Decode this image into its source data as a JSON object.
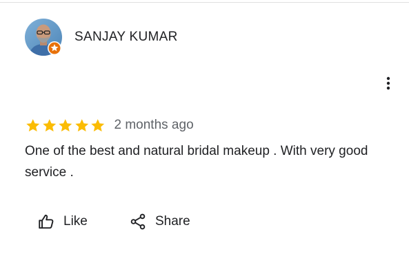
{
  "review": {
    "author": "SANJAY KUMAR",
    "avatar_icon": "user-photo-avatar",
    "badge_icon": "local-guide-star-badge",
    "rating": 5,
    "rating_max": 5,
    "date": "2 months ago",
    "text": "One of the best and natural bridal makeup . With very good service .",
    "more_icon": "more-vert-icon"
  },
  "actions": {
    "like_label": "Like",
    "like_icon": "thumb-up-icon",
    "share_label": "Share",
    "share_icon": "share-icon"
  },
  "colors": {
    "star": "#fbbc04",
    "badge": "#e8710a",
    "text_primary": "#202124",
    "text_secondary": "#5f6368",
    "divider": "#e0e0e0"
  }
}
